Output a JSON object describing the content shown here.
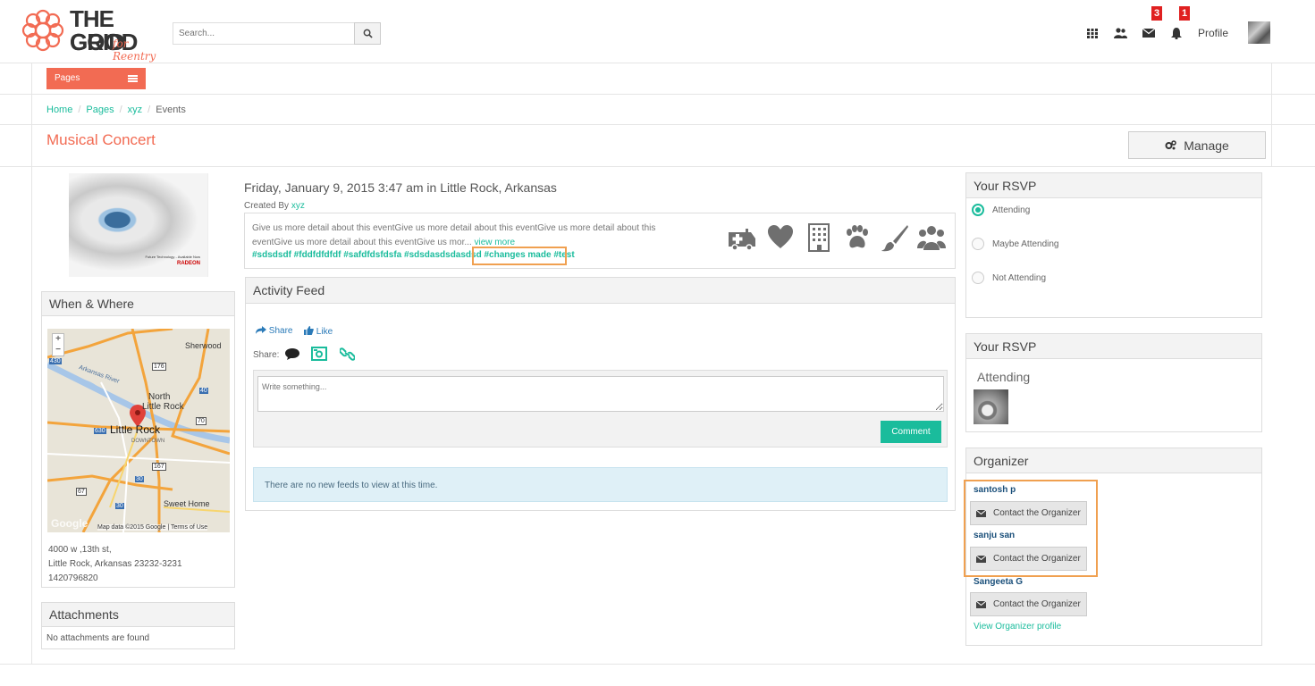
{
  "header": {
    "logo_line1": "THE GOOD",
    "logo_line2": "GRID",
    "logo_tagline": "for Reentry",
    "search_placeholder": "Search...",
    "messages_count": "3",
    "notifications_count": "1",
    "profile_label": "Profile"
  },
  "nav": {
    "pages_label": "Pages"
  },
  "breadcrumb": [
    "Home",
    "Pages",
    "xyz",
    "Events"
  ],
  "page": {
    "title": "Musical Concert",
    "manage_label": "Manage"
  },
  "event": {
    "image_caption1": "Future Technology - Available Now",
    "image_caption2": "RADEON",
    "date_location": "Friday, January 9, 2015 3:47 am in Little Rock, Arkansas",
    "created_by_label": "Created By",
    "created_by_user": "xyz",
    "description": "Give us more detail about this eventGive us more detail about this eventGive us more detail about this eventGive us more detail about this eventGive us mor...",
    "view_more": "view more",
    "hashtags": "#sdsdsdf #fddfdfdfdf #safdfdsfdsfa #sdsdasdsdasdsd",
    "hashtags_highlight": "#changes made #test",
    "category_icons": [
      "ambulance-icon",
      "heart-icon",
      "building-icon",
      "paw-icon",
      "paintbrush-icon",
      "group-icon"
    ]
  },
  "when_where": {
    "title": "When & Where",
    "map_labels": {
      "sherwood": "Sherwood",
      "arkansas_river": "Arkansas River",
      "north_little_rock_1": "North",
      "north_little_rock_2": "Little Rock",
      "little_rock": "Little Rock",
      "downtown": "DOWNTOWN",
      "sweet_home": "Sweet Home",
      "r430": "430",
      "r176": "176",
      "r40": "40",
      "r70": "70",
      "r630": "630",
      "r167": "167",
      "r30a": "30",
      "r30b": "30",
      "r67": "67",
      "google": "Google",
      "attribution": "Map data ©2015 Google  |  Terms of Use"
    },
    "address_line1": "4000 w ,13th st,",
    "address_line2": "Little Rock, Arkansas 23232-3231",
    "phone": "1420796820"
  },
  "attachments": {
    "title": "Attachments",
    "empty_text": "No attachments are found"
  },
  "activity": {
    "title": "Activity Feed",
    "share_label": "Share",
    "like_label": "Like",
    "share_prefix": "Share:",
    "write_placeholder": "Write something...",
    "comment_label": "Comment",
    "no_feeds": "There are no new feeds to view at this time."
  },
  "rsvp": {
    "title": "Your RSVP",
    "options": [
      "Attending",
      "Maybe Attending",
      "Not Attending"
    ],
    "selected": "Attending"
  },
  "rsvp_status": {
    "title": "Your RSVP",
    "status": "Attending"
  },
  "organizer": {
    "title": "Organizer",
    "names": [
      "santosh p",
      "sanju san",
      "Sangeeta G"
    ],
    "contact_label": "Contact the Organizer",
    "view_profile": "View Organizer profile"
  },
  "colors": {
    "accent": "#f26b53",
    "link": "#1abc9c",
    "badge": "#e02020",
    "highlight": "#f0a050"
  }
}
